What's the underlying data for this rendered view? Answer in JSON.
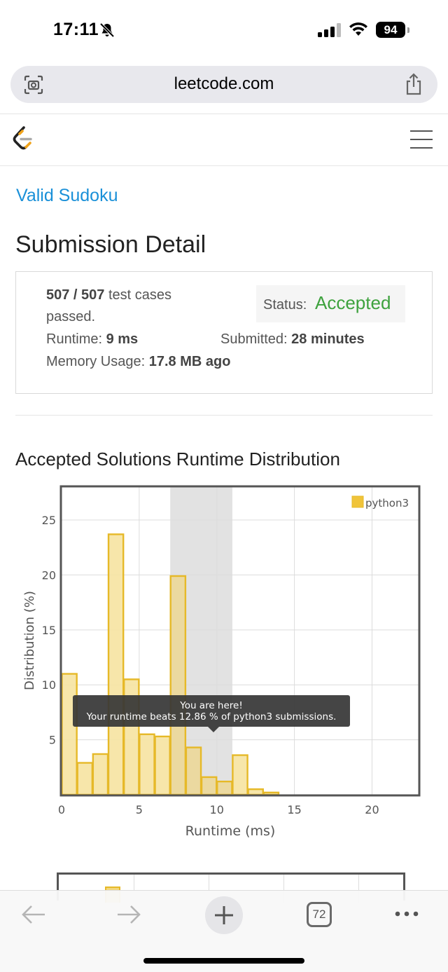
{
  "status_bar": {
    "time": "17:11",
    "battery": "94"
  },
  "browser": {
    "url": "leetcode.com",
    "tab_count": "72"
  },
  "problem": {
    "title": "Valid Sudoku"
  },
  "page_title": "Submission Detail",
  "submission": {
    "test_cases_count": "507 / 507",
    "test_cases_suffix": " test cases",
    "passed_text": "passed.",
    "runtime_label": "Runtime: ",
    "runtime_value": "9 ms",
    "memory_label": "Memory Usage: ",
    "memory_value": "17.8 MB",
    "ago_text": " ago",
    "status_label": "Status: ",
    "status_value": "Accepted",
    "submitted_label": "Submitted: ",
    "submitted_value": "28 minutes"
  },
  "chart_title": "Accepted Solutions Runtime Distribution",
  "tooltip": {
    "line1": "You are here!",
    "line2": "Your runtime beats 12.86 % of python3 submissions."
  },
  "colors": {
    "bar_fill": "#f6e3a1",
    "bar_stroke": "#e6b928",
    "accent_green": "#3ea23e",
    "link_blue": "#1a90d8"
  },
  "chart_data": {
    "type": "bar",
    "title": "",
    "xlabel": "Runtime (ms)",
    "ylabel": "Distribution (%)",
    "xlim": [
      0,
      23
    ],
    "ylim": [
      0,
      28
    ],
    "xticks": [
      0,
      5,
      10,
      15,
      20
    ],
    "yticks": [
      5,
      10,
      15,
      20,
      25
    ],
    "grid": true,
    "legend_position": "top-right",
    "highlight_range": [
      7,
      11
    ],
    "series": [
      {
        "name": "python3",
        "bin_width": 1,
        "bins": [
          0,
          1,
          2,
          3,
          4,
          5,
          6,
          7,
          8,
          9,
          10,
          11,
          12,
          13
        ],
        "values": [
          11,
          2.9,
          3.7,
          23.7,
          10.5,
          5.5,
          5.3,
          19.9,
          4.3,
          1.6,
          1.2,
          3.6,
          0.5,
          0.2
        ]
      }
    ]
  }
}
